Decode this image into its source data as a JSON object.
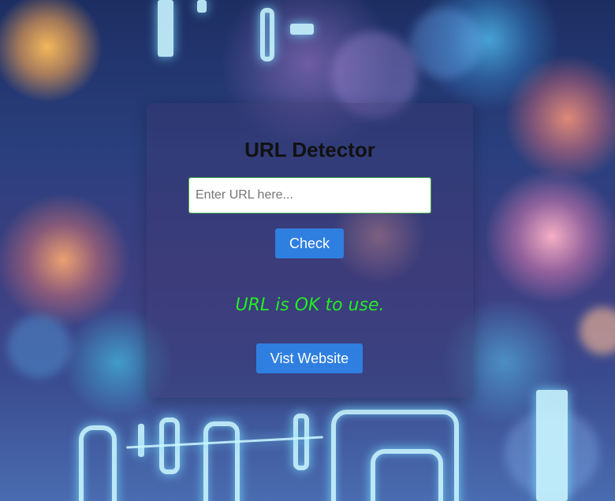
{
  "app": {
    "title": "URL Detector"
  },
  "form": {
    "url_value": "",
    "url_placeholder": "Enter URL here...",
    "check_label": "Check"
  },
  "result": {
    "message": "URL is OK to use.",
    "visit_label": "Vist Website"
  },
  "colors": {
    "button": "#2f7fe0",
    "result_text": "#22ee22",
    "input_border": "#4caf50",
    "title_text": "#111111"
  }
}
